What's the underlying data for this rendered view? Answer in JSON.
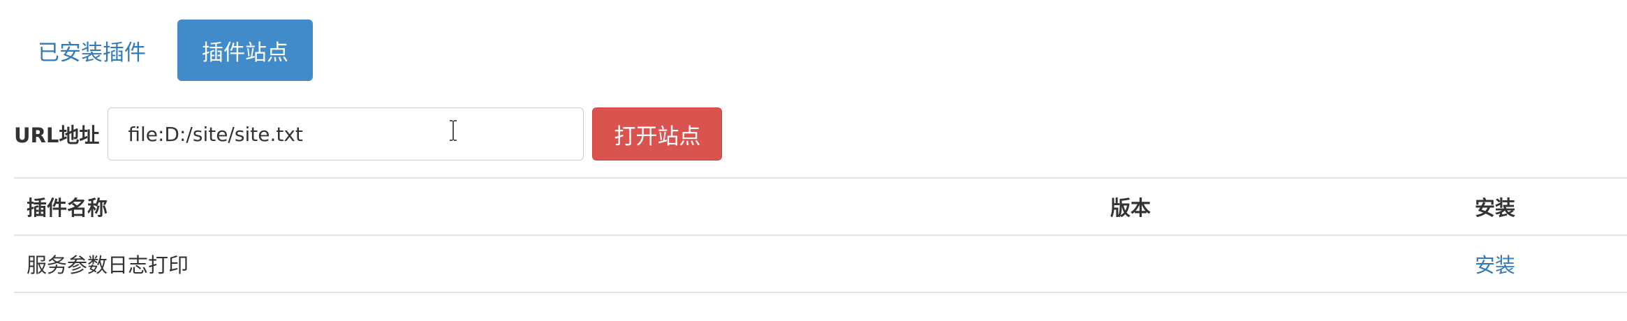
{
  "tabs": {
    "installed": "已安装插件",
    "site": "插件站点"
  },
  "url_row": {
    "label": "URL地址",
    "value": "file:D:/site/site.txt",
    "open_button": "打开站点"
  },
  "table": {
    "headers": {
      "name": "插件名称",
      "version": "版本",
      "install": "安装"
    },
    "rows": [
      {
        "name": "服务参数日志打印",
        "version": "",
        "install": "安装"
      }
    ]
  },
  "colors": {
    "link": "#337ab7",
    "active_tab": "#428bca",
    "danger_button": "#d9534f"
  }
}
